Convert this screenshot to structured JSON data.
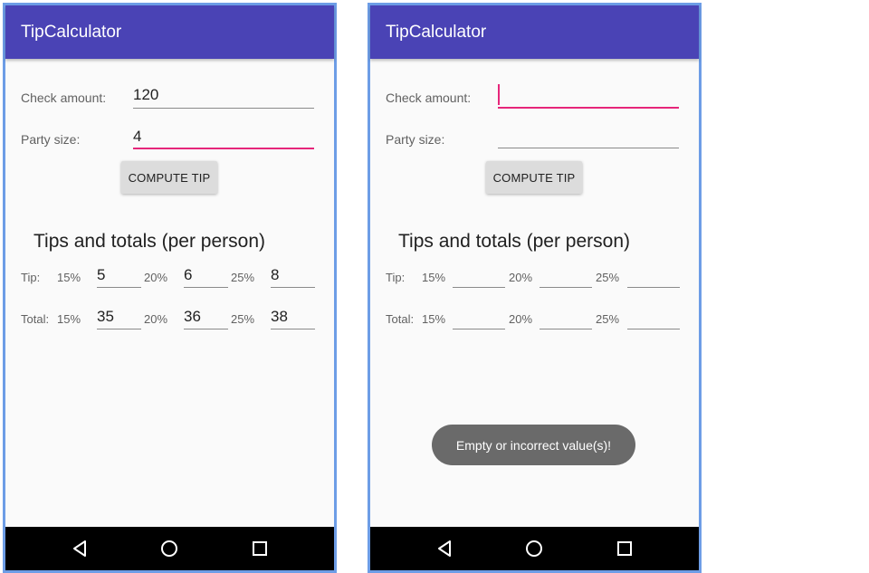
{
  "screens": [
    {
      "app_title": "TipCalculator",
      "check_label": "Check amount:",
      "check_value": "120",
      "party_label": "Party size:",
      "party_value": "4",
      "compute_button": "COMPUTE TIP",
      "section_title": "Tips and totals (per person)",
      "tip_label": "Tip:",
      "total_label": "Total:",
      "pct_15": "15%",
      "pct_20": "20%",
      "pct_25": "25%",
      "tip_values": [
        "5",
        "6",
        "8"
      ],
      "total_values": [
        "35",
        "36",
        "38"
      ],
      "focused_field": "party_size"
    },
    {
      "app_title": "TipCalculator",
      "check_label": "Check amount:",
      "check_value": "",
      "party_label": "Party size:",
      "party_value": "",
      "compute_button": "COMPUTE TIP",
      "section_title": "Tips and totals (per person)",
      "tip_label": "Tip:",
      "total_label": "Total:",
      "pct_15": "15%",
      "pct_20": "20%",
      "pct_25": "25%",
      "tip_values": [
        "",
        "",
        ""
      ],
      "total_values": [
        "",
        "",
        ""
      ],
      "focused_field": "check_amount",
      "toast": "Empty or incorrect value(s)!"
    }
  ],
  "nav_icons": [
    "back-icon",
    "home-icon",
    "recents-icon"
  ],
  "colors": {
    "appbar": "#4a43b5",
    "accent": "#e6267a",
    "frame_border": "#6d9de6",
    "navbar": "#000000",
    "toast": "#6a6a6a"
  }
}
